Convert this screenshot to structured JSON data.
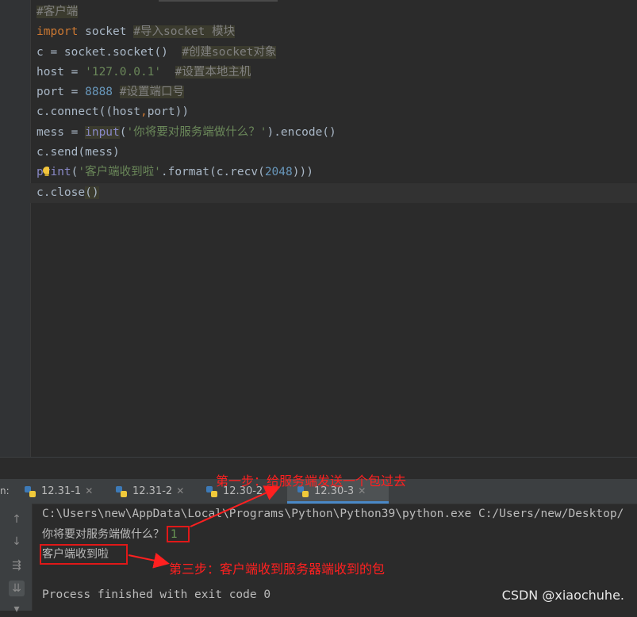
{
  "editor": {
    "lines": [
      {
        "segments": [
          {
            "t": "#客户端",
            "c": "cmt"
          }
        ]
      },
      {
        "segments": [
          {
            "t": "import",
            "c": "kw"
          },
          {
            "t": " socket ",
            "c": ""
          },
          {
            "t": "#导入socket 模块",
            "c": "cmt"
          }
        ]
      },
      {
        "segments": [
          {
            "t": "c = socket.socket()  ",
            "c": ""
          },
          {
            "t": "#创建socket对象",
            "c": "cmt"
          }
        ]
      },
      {
        "segments": [
          {
            "t": "host = ",
            "c": ""
          },
          {
            "t": "'127.0.0.1'",
            "c": "str"
          },
          {
            "t": "  ",
            "c": ""
          },
          {
            "t": "#设置本地主机",
            "c": "cmt"
          }
        ]
      },
      {
        "segments": [
          {
            "t": "port = ",
            "c": ""
          },
          {
            "t": "8888",
            "c": "num"
          },
          {
            "t": " ",
            "c": ""
          },
          {
            "t": "#设置端口号",
            "c": "cmt"
          }
        ]
      },
      {
        "segments": [
          {
            "t": "c.connect((host",
            "c": ""
          },
          {
            "t": ",",
            "c": "kw"
          },
          {
            "t": "port))",
            "c": ""
          }
        ]
      },
      {
        "segments": [
          {
            "t": "mess = ",
            "c": ""
          },
          {
            "t": "input",
            "c": "fn hl"
          },
          {
            "t": "(",
            "c": ""
          },
          {
            "t": "'你将要对服务端做什么？'",
            "c": "str"
          },
          {
            "t": ").encode()",
            "c": ""
          }
        ]
      },
      {
        "segments": [
          {
            "t": "c.send(mess)",
            "c": ""
          }
        ]
      },
      {
        "segments": [
          {
            "t": "print",
            "c": "fn"
          },
          {
            "t": "(",
            "c": ""
          },
          {
            "t": "'客户端收到啦'",
            "c": "str"
          },
          {
            "t": ".format(c.recv(",
            "c": ""
          },
          {
            "t": "2048",
            "c": "num"
          },
          {
            "t": ")))",
            "c": ""
          }
        ]
      },
      {
        "segments": [
          {
            "t": "c.close",
            "c": ""
          },
          {
            "t": "()",
            "c": "hl"
          }
        ]
      }
    ]
  },
  "run_panel": {
    "label": "n:",
    "tabs": [
      {
        "label": "12.31-1",
        "active": false
      },
      {
        "label": "12.31-2",
        "active": false
      },
      {
        "label": "12.30-2",
        "active": false
      },
      {
        "label": "12.30-3",
        "active": true
      }
    ],
    "console": {
      "command": "C:\\Users\\new\\AppData\\Local\\Programs\\Python\\Python39\\python.exe C:/Users/new/Desktop/",
      "prompt": "你将要对服务端做什么？",
      "input_value": "1",
      "received": "客户端收到啦",
      "exit_message": "Process finished with exit code 0"
    },
    "tools": [
      "up-icon",
      "down-icon",
      "soft-wrap-icon",
      "scroll-to-end-icon",
      "more-icon"
    ]
  },
  "annotations": {
    "step1": "第一步：给服务端发送一个包过去",
    "step3": "第三步：客户端收到服务器端收到的包",
    "color": "#ff2020"
  },
  "watermark": "CSDN @xiaochuhe."
}
